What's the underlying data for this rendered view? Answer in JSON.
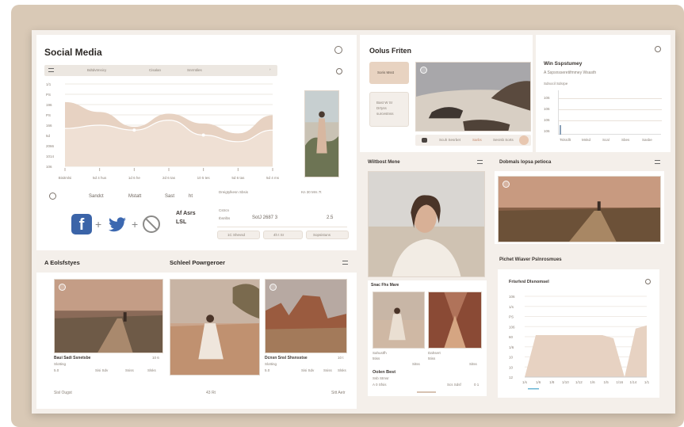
{
  "theme": {
    "accent": "#e8d3c1",
    "panel": "#f4efea",
    "board": "#d9c9b6",
    "chart_fill": "#e7d2c2"
  },
  "social": {
    "title": "Social Media",
    "toolbar": [
      "Bdtdvtmsicy",
      "Cisalan",
      "Snrmtiles"
    ],
    "x_ticks": [
      "Bisitmlsi",
      "5d 4 hus",
      "1d 6 he",
      "2d 6 tas",
      "10 5 tes",
      "5d 6 tas",
      "5d 4 ms"
    ],
    "y_ticks": [
      "1/1",
      "PS",
      "196",
      "PS",
      "166",
      "5d",
      "2066",
      "1014",
      "106"
    ],
    "filters": [
      "Sandct",
      "Mstatt",
      "Sast",
      "ht"
    ],
    "social_label": "Af Asrs\nLSL",
    "info_title": "Dreigtylkesn Sbsis",
    "info_meta": "Kn 30 Mrs 7t",
    "info_row1": "Cstrcn",
    "info_row2": "Ibsnlbs",
    "info_value": "SotJ 2687 3",
    "info_value2": "2.5",
    "info_btns": [
      "1C Shevsd",
      "4h t Sr",
      "Sopsistuns"
    ]
  },
  "chart_data": {
    "type": "area",
    "categories": [
      "Bisitmlsi",
      "5d 4 hus",
      "1d 6 he",
      "2d 6 tas",
      "10 5 tes",
      "5d 6 tas",
      "5d 4 ms"
    ],
    "series": [
      {
        "values": [
          78,
          66,
          48,
          64,
          52,
          40,
          62
        ]
      },
      {
        "values": [
          46,
          50,
          44,
          56,
          38,
          30,
          44
        ]
      }
    ]
  },
  "photo_card": {
    "title": "Oolus Friten",
    "btn1": "Soris Msst",
    "btn2": "Bast W Sr\nDrtyss\nsurcestnss",
    "controls": [
      "Scuh Sesrbet",
      "Sarbs",
      "Sesrsb Sorts"
    ]
  },
  "weekly": {
    "title": "Win Sspstumey",
    "subtitle": "A Sspsnsseretifmmey Wsasth",
    "small": "Sdnocil Sdsrpe",
    "y": [
      "106",
      "106",
      "106",
      "106",
      "106"
    ],
    "x": [
      "Tslsrdlt",
      "Mnkd",
      "Scal",
      "Sbes",
      "Sasbe"
    ]
  },
  "section_left": {
    "title": "A Eolsfstyes",
    "title2": "Schleel Powrgeroer"
  },
  "gallery": [
    {
      "title": "Baui Sadi Ssnetsbe",
      "meta": "10 6",
      "sub": "Slotting",
      "stat": "5.0",
      "tags": [
        "Sisi Sdv",
        "Ssiss",
        "Slsks"
      ]
    },
    {
      "title": "",
      "meta": "",
      "sub": "",
      "stat": "",
      "tags": []
    },
    {
      "title": "Dcnsn Snsl Shsnsstse",
      "meta": "10 t",
      "sub": "Slotting",
      "stat": "5.0",
      "tags": [
        "Sisi Sdv",
        "Ssiss",
        "Slsks"
      ]
    }
  ],
  "bottom_left": {
    "left": "Sisl Ougst",
    "mid": "43 Rt",
    "right": "Sitt Aetr"
  },
  "portrait": {
    "title": "Wiltbost Mene",
    "sub": "Snac Fhs Mare",
    "items": [
      {
        "t": "Sahustfh",
        "m": "5tiss",
        "s": "Sitss"
      },
      {
        "t": "Dahsert",
        "m": "5tiss",
        "s": "Sitss"
      }
    ],
    "foot_title": "Oolen Best",
    "foot_sub": "Ssb Stmsr",
    "foot_meta": "A 0 Sfsis",
    "foot_link": "Scs Sdsf",
    "foot_count": "0 1"
  },
  "landscape": {
    "title": "Dobmals lopsa petioca",
    "sub": "Pichet Wiaver Pslnrosmues"
  },
  "metric": {
    "title": "Frisrlvsl Dlsnomsel",
    "y": [
      "106",
      "1/s",
      "PS",
      "106",
      "60",
      "1/6",
      "10",
      "10",
      "12"
    ],
    "x": [
      "1/s",
      "1/6",
      "1/8",
      "1/10",
      "1/12",
      "1/6",
      "1/5",
      "1/16",
      "1/14",
      "1/1"
    ],
    "values": [
      0,
      52,
      52,
      52,
      52,
      52,
      52,
      52,
      48,
      0,
      60,
      64
    ]
  }
}
